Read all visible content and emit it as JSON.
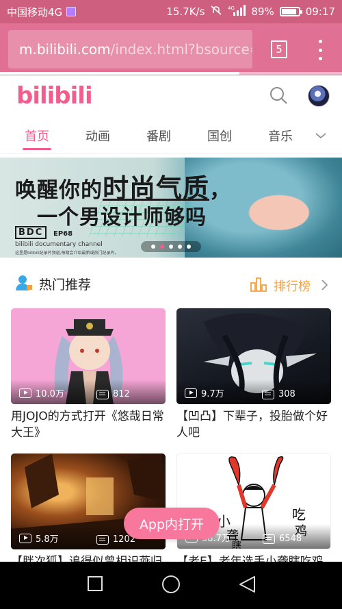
{
  "status_bar": {
    "carrier": "中国移动4G",
    "speed": "15.7K/s",
    "network": "4G",
    "battery": "89%",
    "battery_level": 0.89,
    "time": "09:17"
  },
  "browser": {
    "url_host": "m.bilibili.com",
    "url_path": "/index.html?bsource=",
    "tab_count": "5",
    "load_progress": 0.7
  },
  "header": {
    "logo_text": "bilibili"
  },
  "nav": {
    "tabs": [
      "首页",
      "动画",
      "番剧",
      "国创",
      "音乐"
    ],
    "active_index": 0
  },
  "banner": {
    "line1_a": "唤醒你的",
    "line1_b": "时尚气质",
    "line1_c": "，",
    "line2": "一个男设计师够吗",
    "badge": "BDC",
    "episode": "EP68",
    "channel": "bilibili documentary channel",
    "caption": "这里是bilibili纪录片频道,每期会介绍最新或热门纪录片。",
    "slides": 5,
    "active_slide": 1
  },
  "section": {
    "title": "热门推荐",
    "rank_label": "排行榜"
  },
  "videos": [
    {
      "views": "10.0万",
      "danmaku": "812",
      "title": "用JOJO的方式打开《悠哉日常大王》"
    },
    {
      "views": "9.7万",
      "danmaku": "308",
      "title": "【凹凸】下辈子，投胎做个好人吧"
    },
    {
      "views": "5.8万",
      "danmaku": "1202",
      "title": "【胖次狐】追得似曾相识燕归"
    },
    {
      "views": "58.7万",
      "danmaku": "6548",
      "title": "【老E】老年选手小聋瞎吃鸡"
    }
  ],
  "thumb_text": {
    "v4_a": "小",
    "v4_b": "聋",
    "v4_c": "瞎",
    "v4_d": "吃",
    "v4_e": "鸡"
  },
  "app_button": "App内打开",
  "colors": {
    "brand_pink": "#f25d8e",
    "toolbar": "#e07094",
    "statusbar": "#cf5f7e",
    "rank_orange": "#f7a13e"
  }
}
